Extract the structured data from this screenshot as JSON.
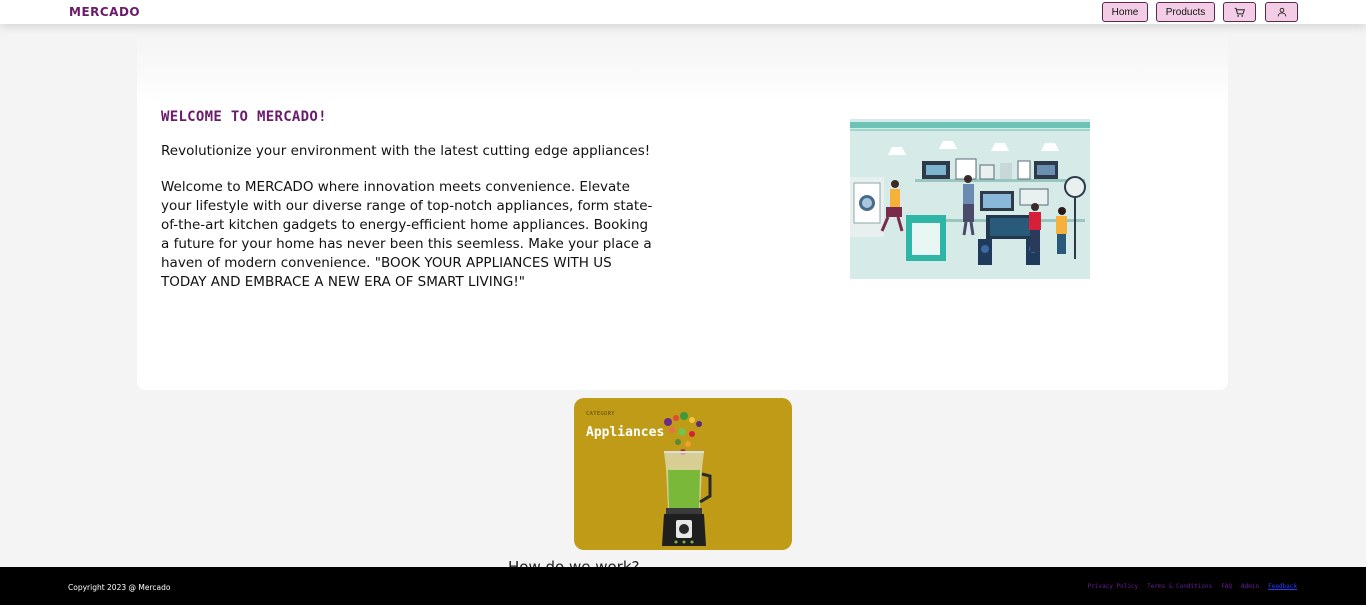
{
  "navbar": {
    "brand": "MERCADO",
    "home_label": "Home",
    "products_label": "Products",
    "cart_icon": "cart-icon",
    "user_icon": "user-icon"
  },
  "hero": {
    "title": "WELCOME TO MERCADO!",
    "tagline": "Revolutionize your environment with the latest cutting edge appliances!",
    "intro": "Welcome to MERCADO where innovation meets convenience. Elevate your lifestyle with our diverse range of top-notch appliances, form state-of-the-art kitchen gadgets to energy-efficient home appliances. Booking a future for your home has never been this seemless. Make your place a haven of modern convenience. \"BOOK YOUR APPLIANCES WITH US TODAY AND EMBRACE A NEW ERA OF SMART LIVING!\""
  },
  "category_card": {
    "label": "CATEGORY",
    "name": "Appliances",
    "color": "#bf9b17"
  },
  "section": {
    "how_heading": "How do we work?"
  },
  "footer": {
    "copyright": "Copyright 2023 @ Mercado",
    "links": [
      "Privacy Policy",
      "Terms & Conditions",
      "FAQ",
      "Admin",
      "Feedback"
    ]
  },
  "colors": {
    "brand": "#6a1b6a",
    "nav_button_bg": "#f3cde6",
    "footer_bg": "#000000"
  }
}
